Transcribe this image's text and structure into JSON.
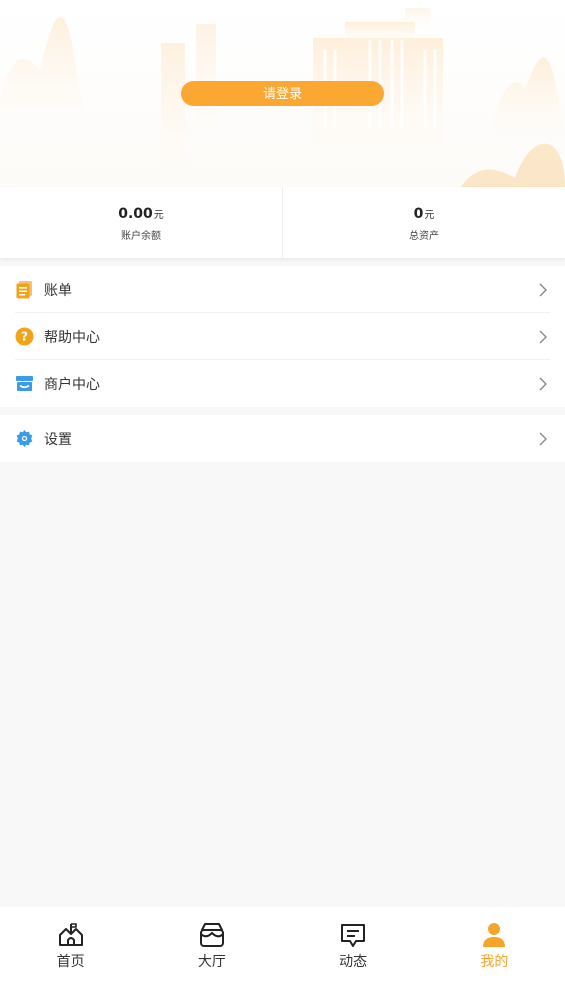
{
  "header": {
    "login_label": "请登录"
  },
  "assets": {
    "balance": {
      "value": "0.00",
      "unit": "元",
      "label": "账户余额"
    },
    "total": {
      "value": "0",
      "unit": "元",
      "label": "总资产"
    }
  },
  "menu": {
    "bill": {
      "label": "账单",
      "icon": "document-icon"
    },
    "help": {
      "label": "帮助中心",
      "icon": "question-icon"
    },
    "merchant": {
      "label": "商户中心",
      "icon": "store-icon"
    },
    "settings": {
      "label": "设置",
      "icon": "gear-icon"
    }
  },
  "tabbar": {
    "home": {
      "label": "首页"
    },
    "hall": {
      "label": "大厅"
    },
    "news": {
      "label": "动态"
    },
    "mine": {
      "label": "我的"
    }
  },
  "colors": {
    "accent": "#faa832",
    "active_tab": "#f6a52c",
    "help_icon": "#f2a31c",
    "blue_icon": "#3a9be8"
  }
}
